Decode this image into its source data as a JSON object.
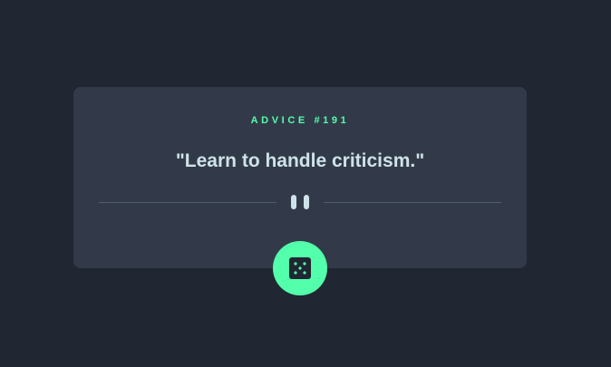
{
  "card": {
    "label": "ADVICE #191",
    "quote": "\"Learn to handle criticism.\""
  },
  "divider": {
    "icon": "pause-icon"
  },
  "button": {
    "icon": "dice-icon"
  },
  "colors": {
    "background": "#202632",
    "card": "#323a49",
    "accent": "#53ffaa",
    "text": "#cee3e9",
    "divider": "#4f5d74"
  }
}
